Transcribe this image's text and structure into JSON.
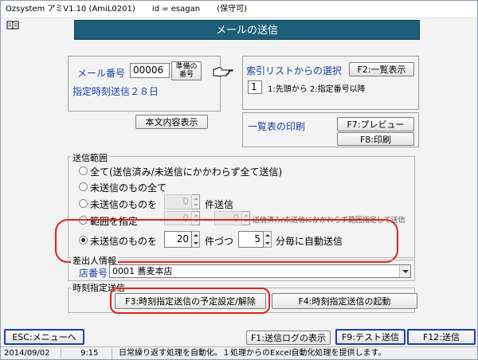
{
  "titlebar": {
    "app": "Ozsystem アミV1.10 (AmiL0201)",
    "id": "id = esagan",
    "perm": "(保守可)"
  },
  "header": {
    "title": "メールの送信"
  },
  "mail": {
    "label": "メール番号",
    "number": "00006",
    "prep_button_line1": "準備の",
    "prep_button_line2": "番号",
    "scheduled_info": "指定時刻送信２８日",
    "show_body_button": "本文内容表示"
  },
  "index": {
    "label": "索引リストからの選択",
    "list_button": "F2:一覧表示",
    "value": "1",
    "desc": "1:先頭から 2:指定番号以降"
  },
  "print": {
    "label": "一覧表の印刷",
    "preview_button": "F7:プレビュー",
    "print_button": "F8:印刷"
  },
  "range": {
    "legend": "送信範囲",
    "opt_all": "全て(送信済み/未送信にかかわらず全て送信)",
    "opt_unsent_all": "未送信のもの全て",
    "opt_unsent_count": "未送信のものを",
    "count_value": "0",
    "count_suffix": "件送信",
    "opt_range": "範囲を指定",
    "range_from": "0",
    "range_sep": "～",
    "range_to": "0",
    "range_note": "送信済み/未送信にかかわらず範囲指定して送信",
    "opt_auto": "未送信のものを",
    "auto_count": "20",
    "auto_count_suffix": "件づつ",
    "auto_minutes": "5",
    "auto_minutes_suffix": "分毎に自動送信"
  },
  "sender": {
    "legend": "差出人情報",
    "store_label": "店番号",
    "store_value": "0001 蕎麦本店"
  },
  "timed": {
    "legend": "時刻指定送信",
    "schedule_button": "F3:時刻指定送信の予定設定/解除",
    "start_button": "F4:時刻指定送信の起動"
  },
  "footer": {
    "esc_button": "ESC:メニューへ",
    "log_button": "F1:送信ログの表示",
    "test_button": "F9:テスト送信",
    "send_button": "F12:送信"
  },
  "status": {
    "date": "2014/09/02",
    "time": "9:15",
    "message": "日常繰り返す処理を自動化。１処理からのExcel自動化処理を提供します。"
  },
  "colors": {
    "header_bg": "#1d5f78",
    "label_blue": "#1c3fa8",
    "highlight_red": "#e2231a"
  }
}
